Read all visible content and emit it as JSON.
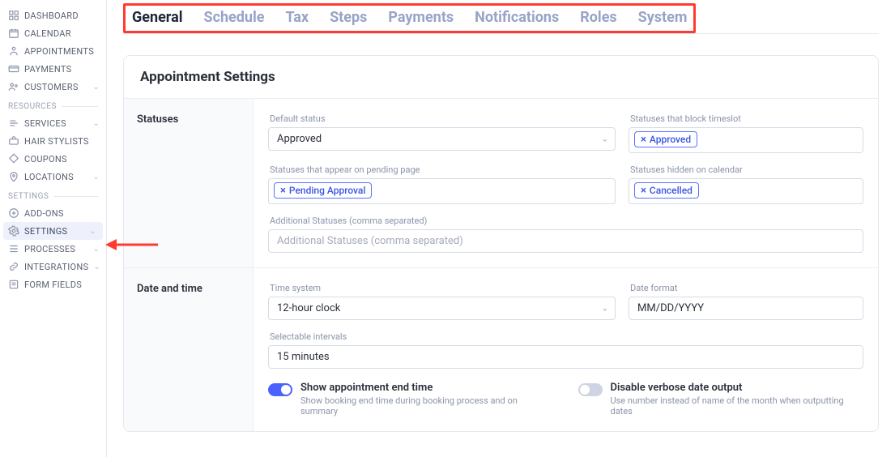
{
  "sidebar": {
    "top": [
      {
        "label": "DASHBOARD",
        "icon": "dashboard",
        "chev": false
      },
      {
        "label": "CALENDAR",
        "icon": "calendar",
        "chev": false
      },
      {
        "label": "APPOINTMENTS",
        "icon": "appointments",
        "chev": false
      },
      {
        "label": "PAYMENTS",
        "icon": "payments",
        "chev": false
      },
      {
        "label": "CUSTOMERS",
        "icon": "customers",
        "chev": true
      }
    ],
    "resources_label": "RESOURCES",
    "resources": [
      {
        "label": "SERVICES",
        "icon": "services",
        "chev": true
      },
      {
        "label": "HAIR STYLISTS",
        "icon": "stylists",
        "chev": false
      },
      {
        "label": "COUPONS",
        "icon": "coupons",
        "chev": false
      },
      {
        "label": "LOCATIONS",
        "icon": "locations",
        "chev": true
      }
    ],
    "settings_label": "SETTINGS",
    "settings": [
      {
        "label": "ADD-ONS",
        "icon": "addons",
        "chev": false
      },
      {
        "label": "SETTINGS",
        "icon": "settings",
        "chev": true,
        "active": true
      },
      {
        "label": "PROCESSES",
        "icon": "processes",
        "chev": true
      },
      {
        "label": "INTEGRATIONS",
        "icon": "integrations",
        "chev": true
      },
      {
        "label": "FORM FIELDS",
        "icon": "formfields",
        "chev": false
      }
    ]
  },
  "tabs": [
    "General",
    "Schedule",
    "Tax",
    "Steps",
    "Payments",
    "Notifications",
    "Roles",
    "System"
  ],
  "active_tab": "General",
  "card_title": "Appointment Settings",
  "sections": {
    "statuses": {
      "label": "Statuses",
      "default_status": {
        "label": "Default status",
        "value": "Approved"
      },
      "block_timeslot": {
        "label": "Statuses that block timeslot",
        "tags": [
          "Approved"
        ]
      },
      "pending_page": {
        "label": "Statuses that appear on pending page",
        "tags": [
          "Pending Approval"
        ]
      },
      "hidden_calendar": {
        "label": "Statuses hidden on calendar",
        "tags": [
          "Cancelled"
        ]
      },
      "additional": {
        "label": "Additional Statuses (comma separated)",
        "placeholder": "Additional Statuses (comma separated)"
      }
    },
    "datetime": {
      "label": "Date and time",
      "time_system": {
        "label": "Time system",
        "value": "12-hour clock"
      },
      "date_format": {
        "label": "Date format",
        "value": "MM/DD/YYYY"
      },
      "intervals": {
        "label": "Selectable intervals",
        "value": "15 minutes"
      },
      "show_end": {
        "on": true,
        "title": "Show appointment end time",
        "desc": "Show booking end time during booking process and on summary"
      },
      "verbose": {
        "on": false,
        "title": "Disable verbose date output",
        "desc": "Use number instead of name of the month when outputting dates"
      }
    }
  },
  "annotation": {
    "tabs_highlight": "#ff3b30",
    "arrow_color": "#ff3b30"
  }
}
